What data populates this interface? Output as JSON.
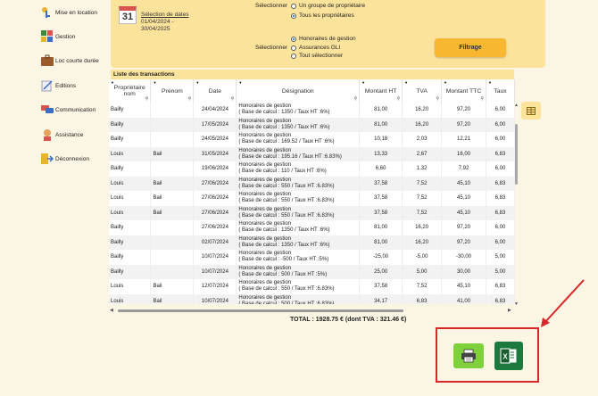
{
  "sidebar": {
    "items": [
      {
        "label": "Mise en location",
        "icon": "keys-icon"
      },
      {
        "label": "Gestion",
        "icon": "gestion-icon"
      },
      {
        "label": "Loc courte durée",
        "icon": "briefcase-icon"
      },
      {
        "label": "Editions",
        "icon": "edit-icon"
      },
      {
        "label": "Communication",
        "icon": "chat-icon"
      },
      {
        "label": "Assistance",
        "icon": "support-icon"
      },
      {
        "label": "Déconnexion",
        "icon": "logout-icon"
      }
    ]
  },
  "filter": {
    "calendar_day": "31",
    "date_link": "Sélection de dates",
    "date_start": "01/04/2024 -",
    "date_end": "30/04/2025",
    "select_label_1": "Sélectionner",
    "owner_options": [
      {
        "label": "Un groupe de propriétaire",
        "checked": false
      },
      {
        "label": "Tous les propriétaires",
        "checked": true
      }
    ],
    "select_label_2": "Sélectionner",
    "type_options": [
      {
        "label": "Honoraires de gestion",
        "checked": true
      },
      {
        "label": "Assurances GLI",
        "checked": false
      },
      {
        "label": "Tout sélectionner",
        "checked": false
      }
    ],
    "filter_button": "Filtrage"
  },
  "transactions": {
    "title": "Liste des transactions",
    "columns": [
      "Propriétaire nom",
      "Prénom",
      "Date",
      "Désignation",
      "Montant HT",
      "TVA",
      "Montant TTC",
      "Taux"
    ],
    "rows": [
      [
        "Bailly",
        "",
        "24/04/2024",
        "Honoraires de gestion",
        "( Base de calcul : 1350 / Taux HT :6%)",
        "81,00",
        "16,20",
        "97,20",
        "6,00"
      ],
      [
        "Bailly",
        "",
        "17/05/2024",
        "Honoraires de gestion",
        "( Base de calcul : 1350 / Taux HT :6%)",
        "81,00",
        "16,20",
        "97,20",
        "6,00"
      ],
      [
        "Bailly",
        "",
        "24/05/2024",
        "Honoraires de gestion",
        "( Base de calcul : 169.52 / Taux HT :6%)",
        "10,18",
        "2,03",
        "12,21",
        "6,00"
      ],
      [
        "Louis",
        "Bail",
        "31/05/2024",
        "Honoraires de gestion",
        "( Base de calcul : 195.16 / Taux HT :6.83%)",
        "13,33",
        "2,67",
        "16,00",
        "6,83"
      ],
      [
        "Bailly",
        "",
        "19/06/2024",
        "Honoraires de gestion",
        "( Base de calcul : 110 / Taux HT :6%)",
        "6,60",
        "1,32",
        "7,92",
        "6,00"
      ],
      [
        "Louis",
        "Bail",
        "27/06/2024",
        "Honoraires de gestion",
        "( Base de calcul : 550 / Taux HT :6.83%)",
        "37,58",
        "7,52",
        "45,10",
        "6,83"
      ],
      [
        "Louis",
        "Bail",
        "27/06/2024",
        "Honoraires de gestion",
        "( Base de calcul : 550 / Taux HT :6.83%)",
        "37,58",
        "7,52",
        "45,10",
        "6,83"
      ],
      [
        "Louis",
        "Bail",
        "27/06/2024",
        "Honoraires de gestion",
        "( Base de calcul : 550 / Taux HT :6.83%)",
        "37,58",
        "7,52",
        "45,10",
        "6,83"
      ],
      [
        "Bailly",
        "",
        "27/06/2024",
        "Honoraires de gestion",
        "( Base de calcul : 1350 / Taux HT :6%)",
        "81,00",
        "16,20",
        "97,20",
        "6,00"
      ],
      [
        "Bailly",
        "",
        "02/07/2024",
        "Honoraires de gestion",
        "( Base de calcul : 1350 / Taux HT :6%)",
        "81,00",
        "16,20",
        "97,20",
        "6,00"
      ],
      [
        "Bailly",
        "",
        "10/07/2024",
        "Honoraires de gestion",
        "( Base de calcul : -500 / Taux HT :5%)",
        "-25,00",
        "-5,00",
        "-30,00",
        "5,00"
      ],
      [
        "Bailly",
        "",
        "10/07/2024",
        "Honoraires de gestion",
        "( Base de calcul : 500 / Taux HT :5%)",
        "25,00",
        "5,00",
        "30,00",
        "5,00"
      ],
      [
        "Louis",
        "Bail",
        "12/07/2024",
        "Honoraires de gestion",
        "( Base de calcul : 550 / Taux HT :6.83%)",
        "37,58",
        "7,52",
        "45,10",
        "6,83"
      ],
      [
        "Louis",
        "Bail",
        "10/07/2024",
        "Honoraires de gestion",
        "( Base de calcul : 500 / Taux HT :6.83%)",
        "34,17",
        "6,83",
        "41,00",
        "6,83"
      ]
    ]
  },
  "total": "TOTAL : 1928.75 € (dont TVA : 321.46 €)",
  "export": {
    "print": "printer-icon",
    "excel": "excel-icon"
  },
  "colors": {
    "panel": "#fbe39b",
    "button": "#f7b731",
    "print": "#7fd13b",
    "excel": "#1d7a3e",
    "highlight": "#d8262b"
  }
}
